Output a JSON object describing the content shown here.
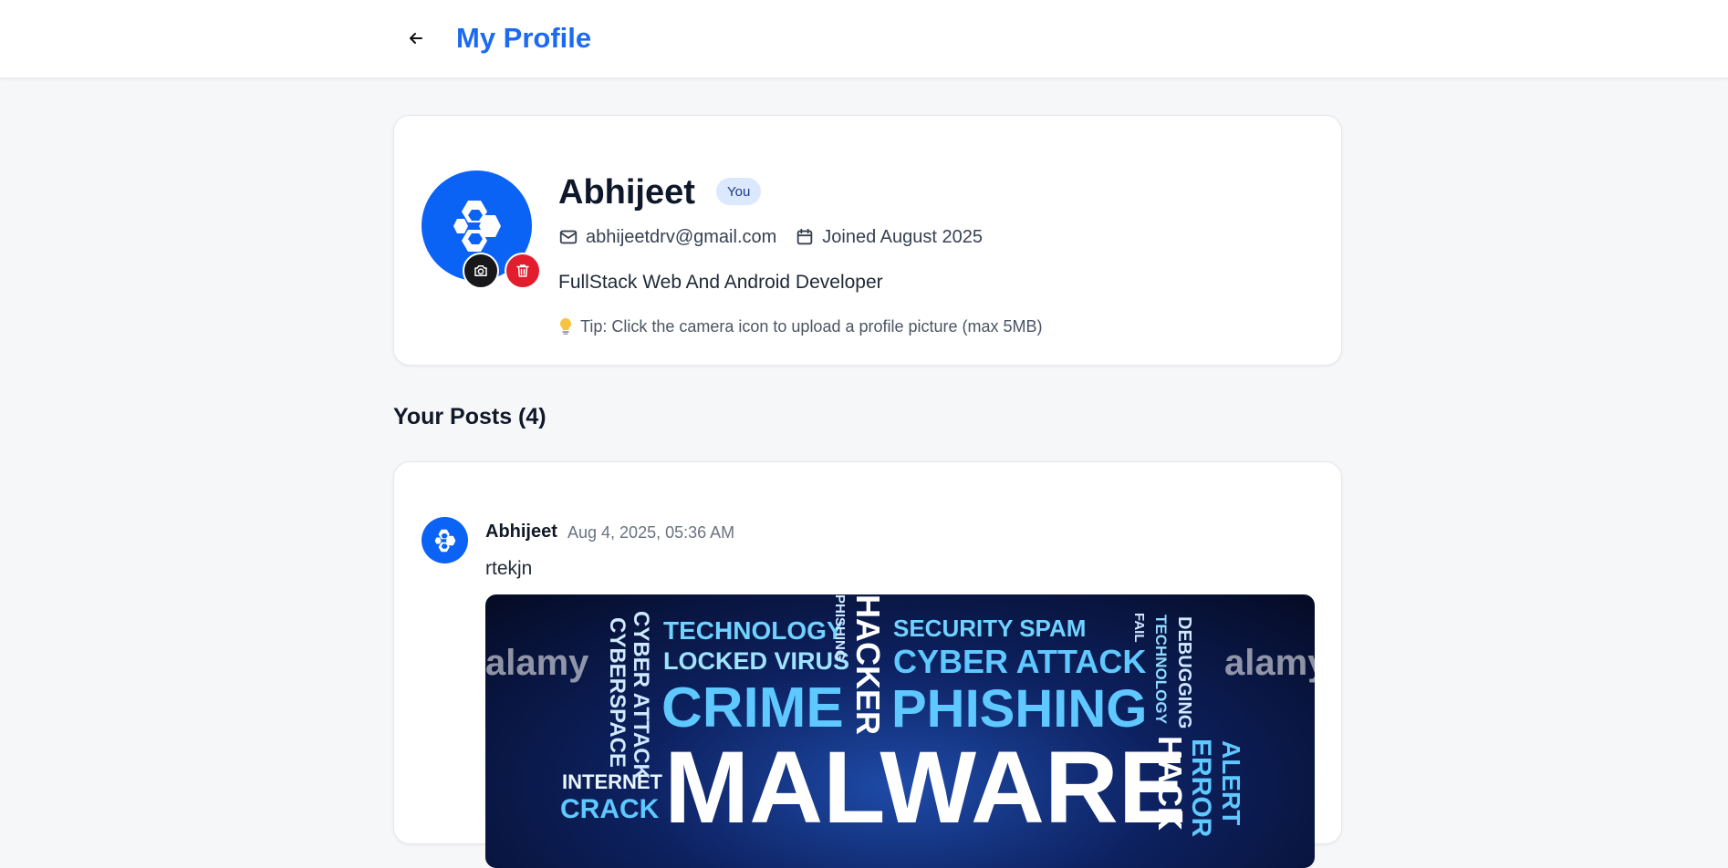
{
  "header": {
    "back_icon": "arrow-left-icon",
    "title": "My Profile"
  },
  "profile": {
    "name": "Abhijeet",
    "badge": "You",
    "email": "abhijeetdrv@gmail.com",
    "joined": "Joined August 2025",
    "bio": "FullStack Web And Android Developer",
    "tip": "Tip: Click the camera icon to upload a profile picture (max 5MB)",
    "avatar_color": "#0b63f6",
    "upload_icon": "camera-icon",
    "delete_icon": "trash-icon"
  },
  "posts": {
    "heading": "Your Posts (4)",
    "items": [
      {
        "author": "Abhijeet",
        "timestamp": "Aug 4, 2025, 05:36 AM",
        "text": "rtekjn",
        "image": {
          "words": {
            "technology": "TECHNOLOGY",
            "security_spam": "SECURITY SPAM",
            "locked_virus": "LOCKED VIRUS",
            "cyber_attack": "CYBER ATTACK",
            "crime": "CRIME",
            "phishing": "PHISHING",
            "malware": "MALWARE",
            "internet": "INTERNET",
            "crack": "CRACK",
            "cyber_attack_v": "CYBER ATTACK",
            "cyberspace_v": "CYBERSPACE",
            "phishing_v": "PHISHING",
            "hacker_v": "HACKER",
            "fail_v": "FAIL",
            "technology_v": "TECHNOLOGY",
            "debugging_v": "DEBUGGING",
            "hack_v": "HACK",
            "error_v": "ERROR",
            "alert_v": "ALERT"
          },
          "watermark": "alamy"
        }
      }
    ]
  },
  "colors": {
    "accent": "#1d6af2",
    "danger": "#e11d2e",
    "dark": "#18181b"
  }
}
